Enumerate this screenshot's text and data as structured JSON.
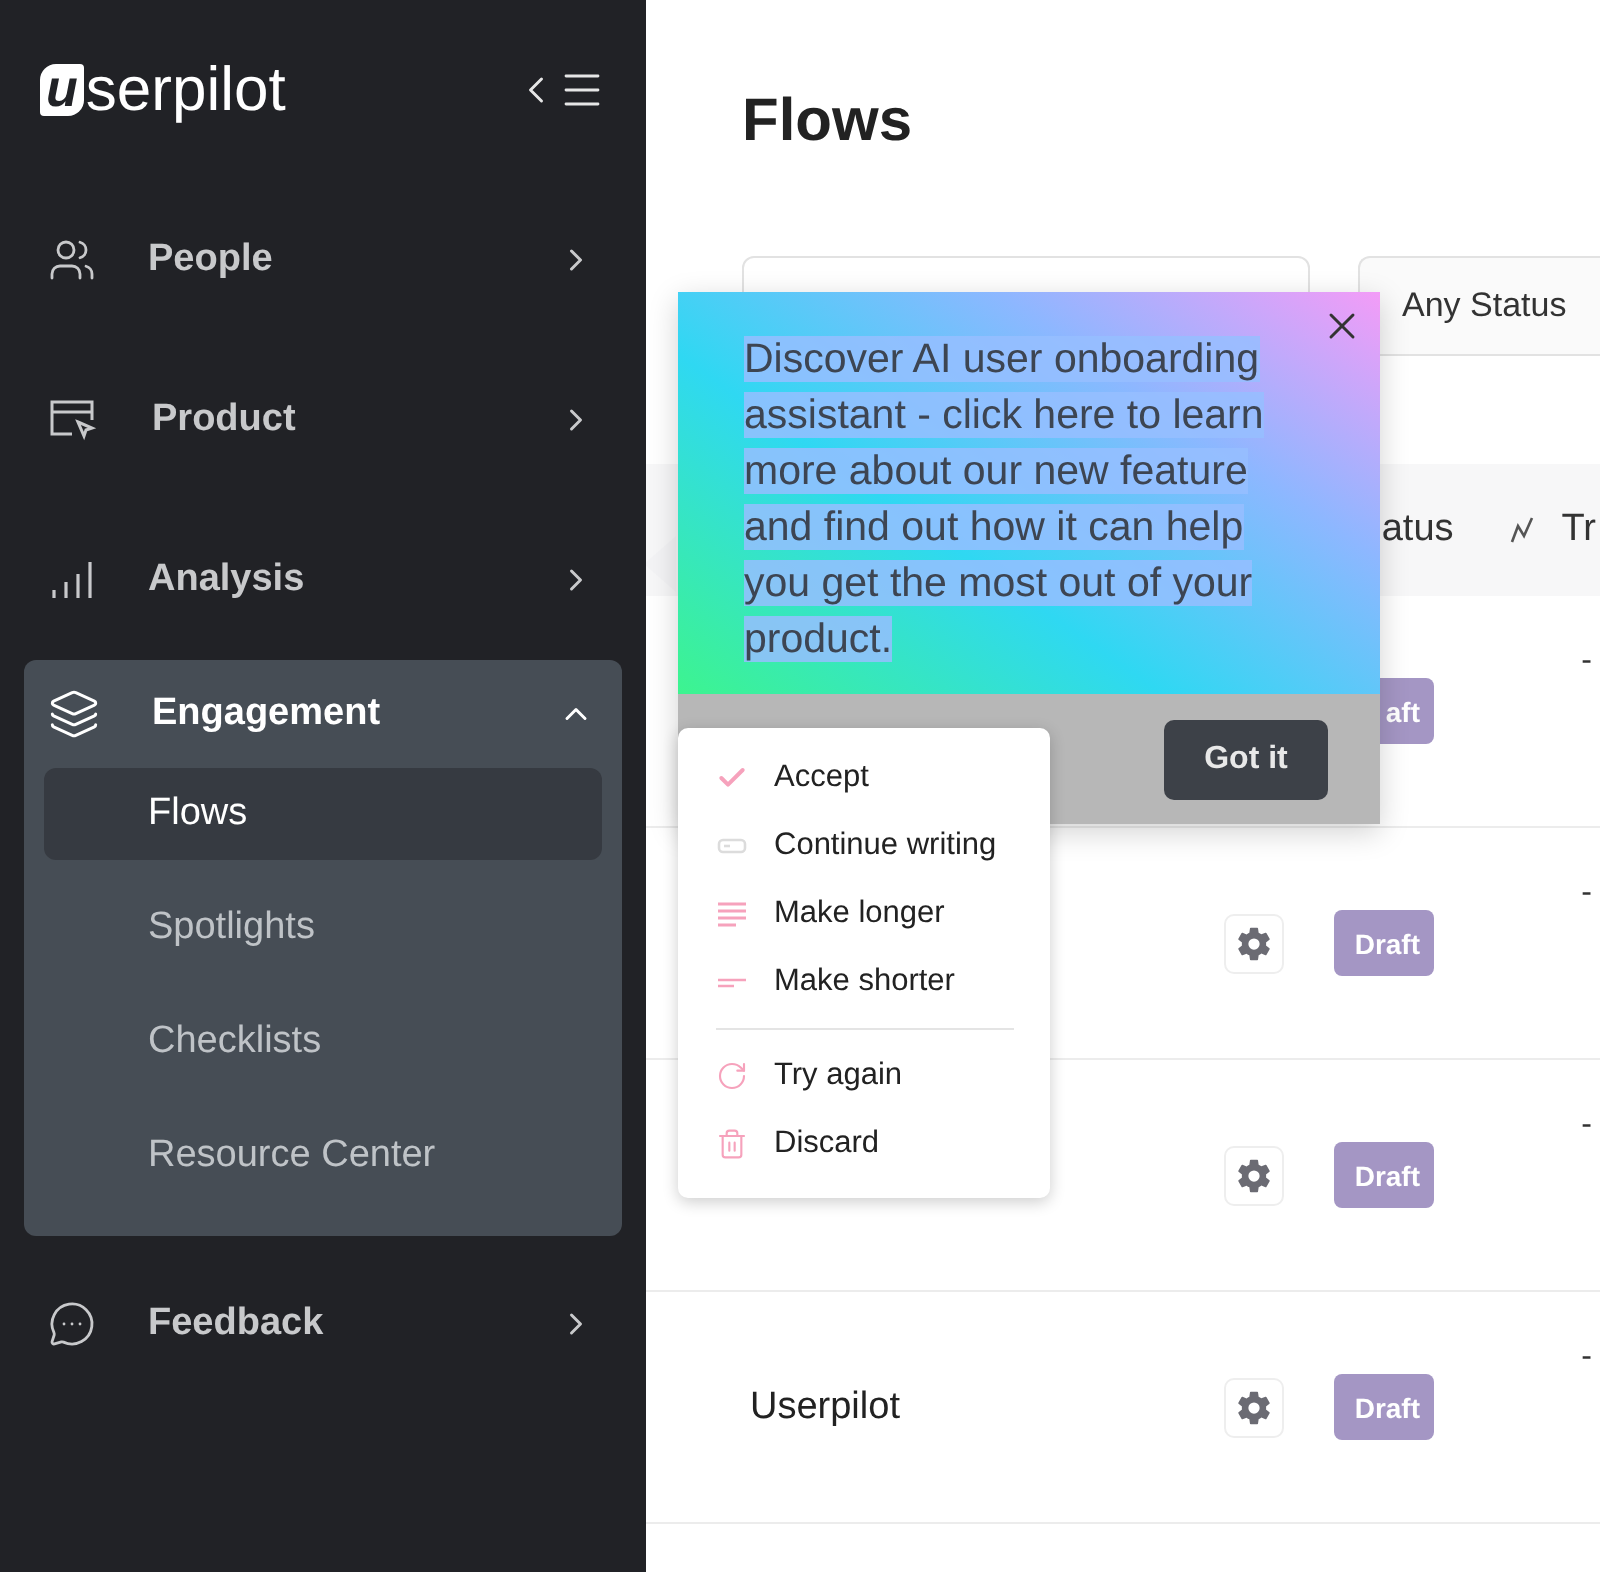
{
  "sidebar": {
    "logo": {
      "mark": "u",
      "text": "serpilot"
    },
    "items": [
      {
        "label": "People",
        "kind": "people",
        "expanded": false
      },
      {
        "label": "Product",
        "kind": "product",
        "expanded": false
      },
      {
        "label": "Analysis",
        "kind": "analysis",
        "expanded": false
      },
      {
        "label": "Engagement",
        "kind": "engagement",
        "expanded": true,
        "children": [
          {
            "label": "Flows",
            "selected": true
          },
          {
            "label": "Spotlights",
            "selected": false
          },
          {
            "label": "Checklists",
            "selected": false
          },
          {
            "label": "Resource Center",
            "selected": false
          }
        ]
      },
      {
        "label": "Feedback",
        "kind": "feedback",
        "expanded": false
      }
    ]
  },
  "page": {
    "title": "Flows"
  },
  "filters": {
    "status": "Any Status"
  },
  "table": {
    "columns": [
      {
        "label": "atus",
        "kind": "plain"
      },
      {
        "label": "Tr",
        "kind": "trigger"
      }
    ],
    "rows": [
      {
        "status": "aft",
        "column_4": "-"
      },
      {
        "gear": true,
        "status": "Draft",
        "column_4": "-"
      },
      {
        "gear": true,
        "status": "Draft",
        "column_4": "-"
      },
      {
        "name": "Userpilot",
        "gear": true,
        "status": "Draft",
        "column_4": "-"
      }
    ]
  },
  "popup": {
    "text": " Discover AI user onboarding assistant - click here to learn more about our new feature and find out how it can help you get the most out of your product.",
    "button": "Got it"
  },
  "menu": {
    "groups": [
      [
        {
          "label": "Accept",
          "kind": "accept"
        },
        {
          "label": "Continue writing",
          "kind": "continue"
        },
        {
          "label": "Make longer",
          "kind": "longer"
        },
        {
          "label": "Make shorter",
          "kind": "shorter"
        }
      ],
      [
        {
          "label": "Try again",
          "kind": "retry"
        },
        {
          "label": "Discard",
          "kind": "discard"
        }
      ]
    ]
  }
}
